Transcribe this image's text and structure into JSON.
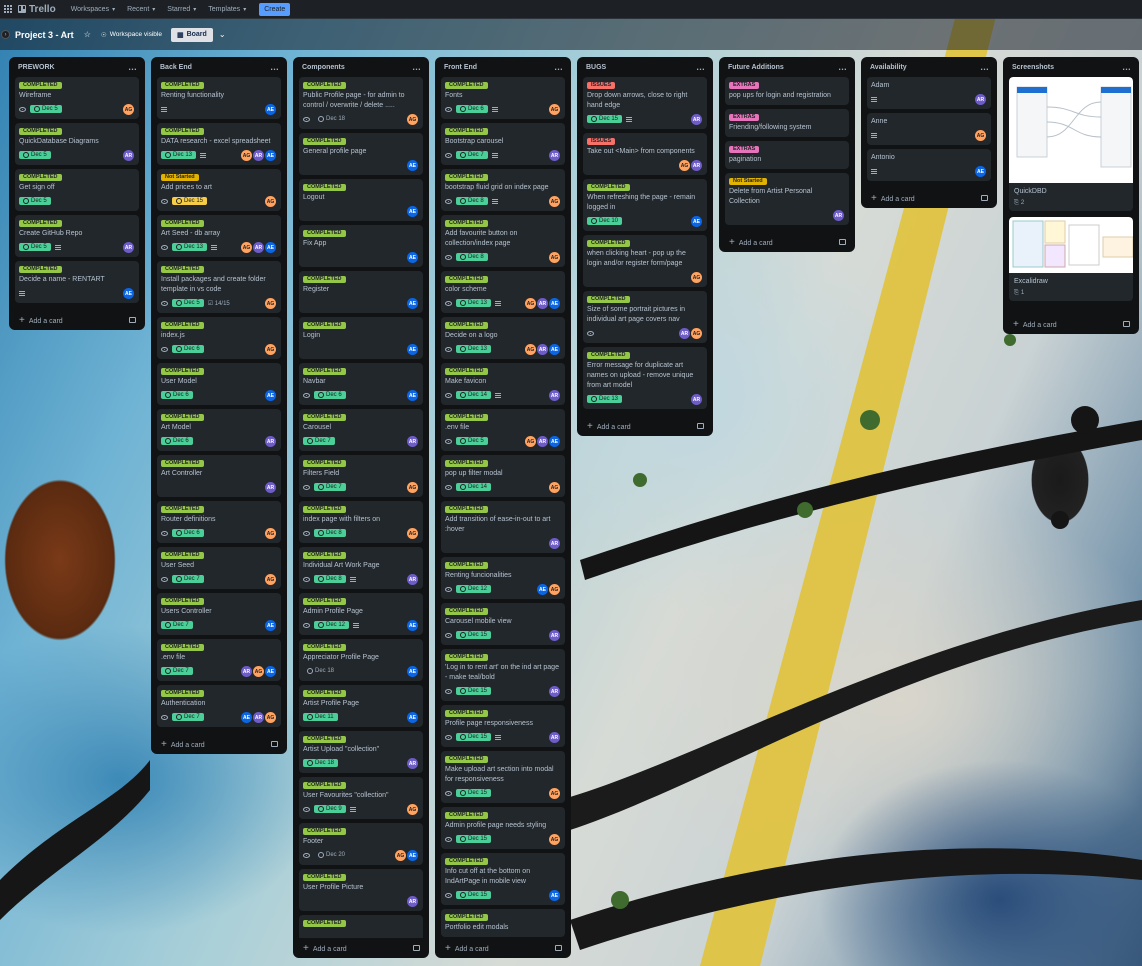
{
  "topbar": {
    "logo": "Trello",
    "nav": [
      "Workspaces",
      "Recent",
      "Starred",
      "Templates"
    ],
    "create": "Create"
  },
  "board": {
    "title": "Project 3 - Art",
    "visibility": "Workspace visible",
    "view": "Board"
  },
  "add_card": "Add a card",
  "colors": {
    "completed": "#94c748",
    "issues": "#f87168",
    "extras": "#e774bb",
    "not_started": "#e2b203",
    "due_green": "#4bce97",
    "due_yellow": "#f5cd47",
    "AG": "#fea362",
    "AR": "#6e5dc6",
    "AE": "#0c66e4"
  },
  "lists": [
    {
      "title": "PREWORK",
      "cards": [
        {
          "label": "COMPLETED",
          "kind": "completed",
          "title": "Wireframe",
          "eye": true,
          "due": "Dec 5",
          "dueKind": "green",
          "av": [
            "AG"
          ]
        },
        {
          "label": "COMPLETED",
          "kind": "completed",
          "title": "QuickDatabase Diagrams",
          "due": "Dec 5",
          "dueKind": "green",
          "av": [
            "AR"
          ]
        },
        {
          "label": "COMPLETED",
          "kind": "completed",
          "title": "Get sign off",
          "due": "Dec 5",
          "dueKind": "green"
        },
        {
          "label": "COMPLETED",
          "kind": "completed",
          "title": "Create GitHub Repo",
          "due": "Dec 5",
          "dueKind": "green",
          "desc": true,
          "av": [
            "AR"
          ]
        },
        {
          "label": "COMPLETED",
          "kind": "completed",
          "title": "Decide a name - RENTART",
          "desc": true,
          "av": [
            "AE"
          ]
        }
      ]
    },
    {
      "title": "Back End",
      "cards": [
        {
          "label": "COMPLETED",
          "kind": "completed",
          "title": "Renting functionality",
          "desc": true,
          "av": [
            "AE"
          ]
        },
        {
          "label": "COMPLETED",
          "kind": "completed",
          "title": "DATA research - excel spreadsheet",
          "due": "Dec 13",
          "dueKind": "green",
          "desc": true,
          "av": [
            "AG",
            "AR",
            "AE"
          ]
        },
        {
          "label": "Not Started",
          "kind": "notstarted",
          "title": "Add prices to art",
          "eye": true,
          "due": "Dec 15",
          "dueKind": "yellow",
          "av": [
            "AG"
          ]
        },
        {
          "label": "COMPLETED",
          "kind": "completed",
          "title": "Art Seed - db array",
          "eye": true,
          "due": "Dec 13",
          "dueKind": "green",
          "desc": true,
          "av": [
            "AG",
            "AR",
            "AE"
          ]
        },
        {
          "label": "COMPLETED",
          "kind": "completed",
          "title": "Install packages and create folder template in vs code",
          "eye": true,
          "due": "Dec 5",
          "dueKind": "green",
          "check": "14/15",
          "av": [
            "AG"
          ]
        },
        {
          "label": "COMPLETED",
          "kind": "completed",
          "title": "index.js",
          "eye": true,
          "due": "Dec 6",
          "dueKind": "green",
          "av": [
            "AG"
          ]
        },
        {
          "label": "COMPLETED",
          "kind": "completed",
          "title": "User Model",
          "due": "Dec 6",
          "dueKind": "green",
          "av": [
            "AE"
          ]
        },
        {
          "label": "COMPLETED",
          "kind": "completed",
          "title": "Art Model",
          "due": "Dec 6",
          "dueKind": "green",
          "av": [
            "AR"
          ]
        },
        {
          "label": "COMPLETED",
          "kind": "completed",
          "title": "Art Controller",
          "tall": true,
          "av": [
            "AR"
          ]
        },
        {
          "label": "COMPLETED",
          "kind": "completed",
          "title": "Router definitions",
          "eye": true,
          "due": "Dec 6",
          "dueKind": "green",
          "av": [
            "AG"
          ]
        },
        {
          "label": "COMPLETED",
          "kind": "completed",
          "title": "User Seed",
          "eye": true,
          "due": "Dec 7",
          "dueKind": "green",
          "av": [
            "AG"
          ]
        },
        {
          "label": "COMPLETED",
          "kind": "completed",
          "title": "Users Controller",
          "due": "Dec 7",
          "dueKind": "green",
          "av": [
            "AE"
          ]
        },
        {
          "label": "COMPLETED",
          "kind": "completed",
          "title": ".env file",
          "due": "Dec 7",
          "dueKind": "green",
          "av": [
            "AR",
            "AG",
            "AE"
          ]
        },
        {
          "label": "COMPLETED",
          "kind": "completed",
          "title": "Authentication",
          "eye": true,
          "due": "Dec 7",
          "dueKind": "green",
          "av": [
            "AE",
            "AR",
            "AG"
          ]
        }
      ]
    },
    {
      "title": "Components",
      "cards": [
        {
          "label": "COMPLETED",
          "kind": "completed",
          "title": "Public Profile page - for admin to control / overwrite / delete .....",
          "eye": true,
          "due": "Dec 18",
          "dueKind": "plain",
          "av": [
            "AG"
          ]
        },
        {
          "label": "COMPLETED",
          "kind": "completed",
          "title": "General profile page",
          "tall": true,
          "av": [
            "AE"
          ]
        },
        {
          "label": "COMPLETED",
          "kind": "completed",
          "title": "Logout",
          "tall": true,
          "av": [
            "AE"
          ]
        },
        {
          "label": "COMPLETED",
          "kind": "completed",
          "title": "Fix App",
          "tall": true,
          "av": [
            "AE"
          ]
        },
        {
          "label": "COMPLETED",
          "kind": "completed",
          "title": "Register",
          "tall": true,
          "av": [
            "AE"
          ]
        },
        {
          "label": "COMPLETED",
          "kind": "completed",
          "title": "Login",
          "tall": true,
          "av": [
            "AE"
          ]
        },
        {
          "label": "COMPLETED",
          "kind": "completed",
          "title": "Navbar",
          "eye": true,
          "due": "Dec 6",
          "dueKind": "green",
          "av": [
            "AE"
          ]
        },
        {
          "label": "COMPLETED",
          "kind": "completed",
          "title": "Carousel",
          "due": "Dec 7",
          "dueKind": "green",
          "av": [
            "AR"
          ]
        },
        {
          "label": "COMPLETED",
          "kind": "completed",
          "title": "Filters Field",
          "eye": true,
          "due": "Dec 7",
          "dueKind": "green",
          "av": [
            "AG"
          ]
        },
        {
          "label": "COMPLETED",
          "kind": "completed",
          "title": "index page with filters on",
          "eye": true,
          "due": "Dec 8",
          "dueKind": "green",
          "av": [
            "AG"
          ]
        },
        {
          "label": "COMPLETED",
          "kind": "completed",
          "title": "Individual Art Work Page",
          "eye": true,
          "due": "Dec 8",
          "dueKind": "green",
          "desc": true,
          "av": [
            "AR"
          ]
        },
        {
          "label": "COMPLETED",
          "kind": "completed",
          "title": "Admin Profile Page",
          "eye": true,
          "due": "Dec 12",
          "dueKind": "green",
          "desc": true,
          "av": [
            "AE"
          ]
        },
        {
          "label": "COMPLETED",
          "kind": "completed",
          "title": "Appreciator Profile Page",
          "due": "Dec 18",
          "dueKind": "plain",
          "av": [
            "AE"
          ]
        },
        {
          "label": "COMPLETED",
          "kind": "completed",
          "title": "Artist Profile Page",
          "due": "Dec 11",
          "dueKind": "green",
          "av": [
            "AE"
          ]
        },
        {
          "label": "COMPLETED",
          "kind": "completed",
          "title": "Artist Upload \"collection\"",
          "due": "Dec 18",
          "dueKind": "green",
          "av": [
            "AR"
          ]
        },
        {
          "label": "COMPLETED",
          "kind": "completed",
          "title": "User Favourites \"collection\"",
          "eye": true,
          "due": "Dec 9",
          "dueKind": "green",
          "desc": true,
          "av": [
            "AG"
          ]
        },
        {
          "label": "COMPLETED",
          "kind": "completed",
          "title": "Footer",
          "eye": true,
          "due": "Dec 20",
          "dueKind": "plain",
          "av": [
            "AG",
            "AE"
          ]
        },
        {
          "label": "COMPLETED",
          "kind": "completed",
          "title": "User Profile Picture",
          "tall": true,
          "av": [
            "AR"
          ]
        },
        {
          "label": "COMPLETED",
          "kind": "completed",
          "title": "",
          "tall": true
        }
      ]
    },
    {
      "title": "Front End",
      "cards": [
        {
          "label": "COMPLETED",
          "kind": "completed",
          "title": "Fonts",
          "eye": true,
          "due": "Dec 6",
          "dueKind": "green",
          "desc": true,
          "av": [
            "AG"
          ]
        },
        {
          "label": "COMPLETED",
          "kind": "completed",
          "title": "Bootstrap carousel",
          "eye": true,
          "due": "Dec 7",
          "dueKind": "green",
          "desc": true,
          "av": [
            "AR"
          ]
        },
        {
          "label": "COMPLETED",
          "kind": "completed",
          "title": "bootstrap fluid grid on index page",
          "eye": true,
          "due": "Dec 8",
          "dueKind": "green",
          "desc": true,
          "av": [
            "AG"
          ]
        },
        {
          "label": "COMPLETED",
          "kind": "completed",
          "title": "Add favourite button on collection/index page",
          "eye": true,
          "due": "Dec 8",
          "dueKind": "green",
          "av": [
            "AG"
          ]
        },
        {
          "label": "COMPLETED",
          "kind": "completed",
          "title": "color scheme",
          "eye": true,
          "due": "Dec 13",
          "dueKind": "green",
          "desc": true,
          "av": [
            "AG",
            "AR",
            "AE"
          ]
        },
        {
          "label": "COMPLETED",
          "kind": "completed",
          "title": "Decide on a logo",
          "eye": true,
          "due": "Dec 13",
          "dueKind": "green",
          "av": [
            "AG",
            "AR",
            "AE"
          ]
        },
        {
          "label": "COMPLETED",
          "kind": "completed",
          "title": "Make favicon",
          "eye": true,
          "due": "Dec 14",
          "dueKind": "green",
          "desc": true,
          "av": [
            "AR"
          ]
        },
        {
          "label": "COMPLETED",
          "kind": "completed",
          "title": ".env file",
          "eye": true,
          "due": "Dec 5",
          "dueKind": "green",
          "av": [
            "AG",
            "AR",
            "AE"
          ]
        },
        {
          "label": "COMPLETED",
          "kind": "completed",
          "title": "pop up filter modal",
          "eye": true,
          "due": "Dec 14",
          "dueKind": "green",
          "av": [
            "AG"
          ]
        },
        {
          "label": "COMPLETED",
          "kind": "completed",
          "title": "Add transition of ease-in-out to art :hover",
          "tall": true,
          "av": [
            "AR"
          ]
        },
        {
          "label": "COMPLETED",
          "kind": "completed",
          "title": "Renting funcionalities",
          "eye": true,
          "due": "Dec 12",
          "dueKind": "green",
          "av": [
            "AE",
            "AG"
          ]
        },
        {
          "label": "COMPLETED",
          "kind": "completed",
          "title": "Carousel mobile view",
          "eye": true,
          "due": "Dec 15",
          "dueKind": "green",
          "av": [
            "AR"
          ]
        },
        {
          "label": "COMPLETED",
          "kind": "completed",
          "title": "'Log in to rent art' on the ind art page - make teal/bold",
          "eye": true,
          "due": "Dec 15",
          "dueKind": "green",
          "av": [
            "AR"
          ]
        },
        {
          "label": "COMPLETED",
          "kind": "completed",
          "title": "Profile page responsiveness",
          "eye": true,
          "due": "Dec 15",
          "dueKind": "green",
          "desc": true,
          "av": [
            "AR"
          ]
        },
        {
          "label": "COMPLETED",
          "kind": "completed",
          "title": "Make upload art section into modal for responsiveness",
          "eye": true,
          "due": "Dec 15",
          "dueKind": "green",
          "av": [
            "AG"
          ]
        },
        {
          "label": "COMPLETED",
          "kind": "completed",
          "title": "Admin profile page needs styling",
          "eye": true,
          "due": "Dec 15",
          "dueKind": "green",
          "av": [
            "AG"
          ]
        },
        {
          "label": "COMPLETED",
          "kind": "completed",
          "title": "Info cut off at the bottom on IndArtPage in mobile view",
          "eye": true,
          "due": "Dec 15",
          "dueKind": "green",
          "av": [
            "AE"
          ]
        },
        {
          "label": "COMPLETED",
          "kind": "completed",
          "title": "Portfolio edit modals"
        }
      ]
    },
    {
      "title": "BUGS",
      "cards": [
        {
          "label": "ISSUES",
          "kind": "issues",
          "title": "Drop down arrows, close to right hand edge",
          "due": "Dec 15",
          "dueKind": "green",
          "desc": true,
          "av": [
            "AR"
          ]
        },
        {
          "label": "ISSUES",
          "kind": "issues",
          "title": "Take out <Main> from components",
          "tall": true,
          "av": [
            "AG",
            "AR"
          ]
        },
        {
          "label": "COMPLETED",
          "kind": "completed",
          "title": "When refreshing the page - remain logged in",
          "due": "Dec 10",
          "dueKind": "green",
          "av": [
            "AE"
          ]
        },
        {
          "label": "COMPLETED",
          "kind": "completed",
          "title": "when clicking heart - pop up the login and/or register form/page",
          "tall": true,
          "av": [
            "AG"
          ]
        },
        {
          "label": "COMPLETED",
          "kind": "completed",
          "title": "Size of some portrait pictures in individual art page covers nav",
          "eye": true,
          "av": [
            "AR",
            "AG"
          ]
        },
        {
          "label": "COMPLETED",
          "kind": "completed",
          "title": "Error message for duplicate art names on upload - remove unique from art model",
          "due": "Dec 13",
          "dueKind": "green",
          "av": [
            "AR"
          ]
        }
      ]
    },
    {
      "title": "Future Additions",
      "cards": [
        {
          "label": "EXTRAS",
          "kind": "extras",
          "title": "pop ups for login and registration"
        },
        {
          "label": "EXTRAS",
          "kind": "extras",
          "title": "Friending/following system"
        },
        {
          "label": "EXTRAS",
          "kind": "extras",
          "title": "pagination"
        },
        {
          "label": "Not Started",
          "kind": "notstarted",
          "title": "Delete from Artist Personal Collection",
          "tall": true,
          "av": [
            "AR"
          ]
        }
      ]
    },
    {
      "title": "Availability",
      "cards": [
        {
          "title": "Adam",
          "desc": true,
          "av": [
            "AR"
          ]
        },
        {
          "title": "Anne",
          "desc": true,
          "av": [
            "AG"
          ]
        },
        {
          "title": "Antonio",
          "desc": true,
          "av": [
            "AE"
          ]
        }
      ]
    },
    {
      "title": "Screenshots",
      "cards": [
        {
          "title": "QuickDBD",
          "attach": "2",
          "img": "db"
        },
        {
          "title": "Excalidraw",
          "attach": "1",
          "img": "ex"
        }
      ]
    }
  ]
}
